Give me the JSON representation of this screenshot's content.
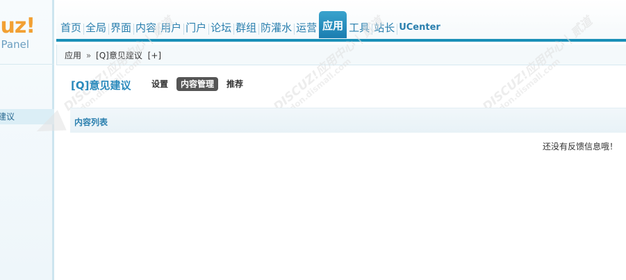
{
  "logo": {
    "main": "cuz",
    "bang": "!",
    "sub": "Panel"
  },
  "sidebar": {
    "items": [
      {
        "label": "建议"
      }
    ]
  },
  "topnav": {
    "items": [
      {
        "label": "首页"
      },
      {
        "label": "全局"
      },
      {
        "label": "界面"
      },
      {
        "label": "内容"
      },
      {
        "label": "用户"
      },
      {
        "label": "门户"
      },
      {
        "label": "论坛"
      },
      {
        "label": "群组"
      },
      {
        "label": "防灌水"
      },
      {
        "label": "运营"
      },
      {
        "label": "应用"
      },
      {
        "label": "工具"
      },
      {
        "label": "站长"
      },
      {
        "label": "UCenter"
      }
    ],
    "active_index": 10
  },
  "breadcrumb": {
    "root": "应用",
    "separator": "»",
    "current": "[Q]意见建议",
    "add_link": "[+]"
  },
  "main": {
    "title": "[Q]意见建议",
    "tabs": [
      {
        "label": "设置"
      },
      {
        "label": "内容管理"
      },
      {
        "label": "推荐"
      }
    ],
    "active_tab": 1,
    "section_title": "内容列表",
    "empty_message": "还没有反馈信息哦！"
  },
  "watermark": {
    "brand": "DISCUZ!应用中心 | 贰道",
    "url": "addon.dismall.com"
  }
}
